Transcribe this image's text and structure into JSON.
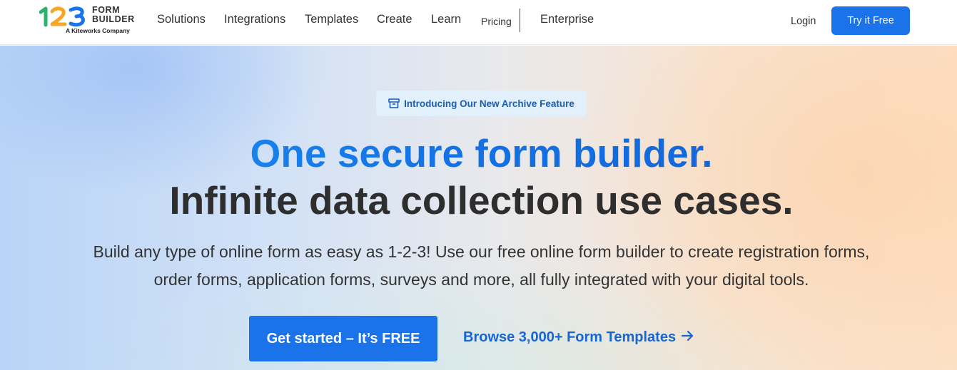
{
  "logo": {
    "word_line1": "FORM",
    "word_line2": "BUILDER",
    "subtitle": "A Kiteworks Company",
    "colors": {
      "one": "#29b36c",
      "two": "#f5a623",
      "three": "#1a73e8"
    }
  },
  "nav": {
    "items": [
      "Solutions",
      "Integrations",
      "Templates",
      "Create",
      "Learn",
      "Pricing",
      "Enterprise"
    ],
    "login": "Login",
    "try_free": "Try it Free"
  },
  "hero": {
    "badge": "Introducing Our New Archive Feature",
    "badge_icon": "archive-icon",
    "title_line1": "One secure form builder.",
    "title_line2": "Infinite data collection use cases.",
    "subtitle_line1": "Build any type of online form as easy as 1-2-3! Use our free online form builder to create registration forms,",
    "subtitle_line2": "order forms, application forms, surveys and more, all fully integrated with your digital tools.",
    "cta": "Get started – It’s FREE",
    "browse": "Browse 3,000+ Form Templates",
    "browse_icon": "arrow-right-icon"
  },
  "colors": {
    "accent": "#1a73e8",
    "title_dark": "#2e2e2e"
  }
}
